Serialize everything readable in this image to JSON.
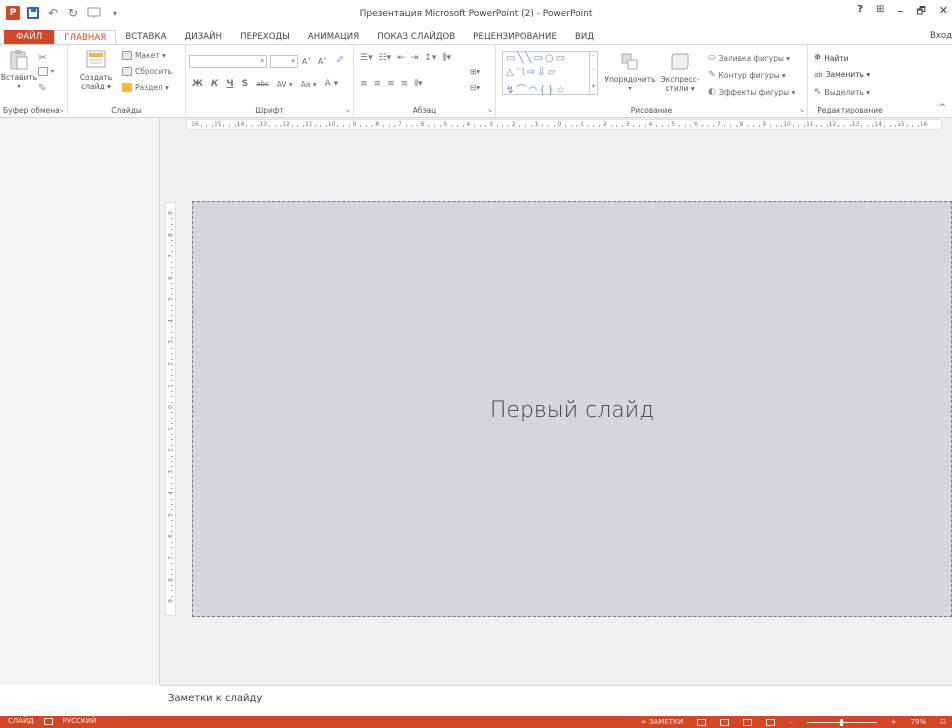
{
  "window": {
    "title": "Презентация Microsoft PowerPoint (2) - PowerPoint",
    "help": "?",
    "restore_ribbon": "⊞",
    "minimize": "–",
    "maximize": "🗗",
    "close": "✕"
  },
  "qat": {
    "app_icon": "P",
    "undo": "↶",
    "redo": "↻",
    "customize": "▾"
  },
  "tabs": [
    "ФАЙЛ",
    "ГЛАВНАЯ",
    "ВСТАВКА",
    "ДИЗАЙН",
    "ПЕРЕХОДЫ",
    "АНИМАЦИЯ",
    "ПОКАЗ СЛАЙДОВ",
    "РЕЦЕНЗИРОВАНИЕ",
    "ВИД"
  ],
  "active_tab": "ГЛАВНАЯ",
  "login": "Вход",
  "ribbon": {
    "clipboard": {
      "label": "Буфер обмена",
      "paste": "Вставить",
      "launcher": "↘"
    },
    "slides": {
      "label": "Слайды",
      "new_slide_1": "Создать",
      "new_slide_2": "слайд ▾",
      "layout": "Макет ▾",
      "reset": "Сбросить",
      "section": "Раздел ▾"
    },
    "font": {
      "label": "Шрифт",
      "bold": "Ж",
      "italic": "К",
      "underline": "Ч",
      "shadow": "S",
      "strike": "abc",
      "spacing": "AV ▾",
      "case": "Aa ▾",
      "color": "A ▾",
      "grow": "A˄",
      "shrink": "A˅",
      "clear": "⌫",
      "launcher": "↘"
    },
    "paragraph": {
      "label": "Абзац",
      "launcher": "↘"
    },
    "drawing": {
      "label": "Рисование",
      "arrange": "Упорядочить",
      "quick_styles_1": "Экспресс-",
      "quick_styles_2": "стили ▾",
      "fill": "Заливка фигуры ▾",
      "outline": "Контур фигуры ▾",
      "effects": "Эффекты фигуры ▾",
      "launcher": "↘"
    },
    "editing": {
      "label": "Редактирование",
      "find": "Найти",
      "replace": "Заменить ▾",
      "select": "Выделить ▾"
    },
    "collapse": "^"
  },
  "ruler": {
    "h_ticks": [
      "16",
      "15",
      "14",
      "13",
      "12",
      "11",
      "10",
      "9",
      "8",
      "7",
      "6",
      "5",
      "4",
      "3",
      "2",
      "1",
      "0",
      "1",
      "2",
      "3",
      "4",
      "5",
      "6",
      "7",
      "8",
      "9",
      "10",
      "11",
      "12",
      "13",
      "14",
      "15",
      "16"
    ],
    "v_ticks": [
      "9",
      "8",
      "7",
      "6",
      "5",
      "4",
      "3",
      "2",
      "1",
      "0",
      "1",
      "2",
      "3",
      "4",
      "5",
      "6",
      "7",
      "8",
      "9"
    ]
  },
  "slide": {
    "title": "Первый слайд",
    "background": "#d4d5df"
  },
  "notes": {
    "placeholder": "Заметки к слайду"
  },
  "status": {
    "slide": "СЛАЙД",
    "language": "РУССКИЙ",
    "notes": "≐ ЗАМЕТКИ",
    "zoom": "79%",
    "fit": "⊡"
  },
  "colors": {
    "accent": "#d24726",
    "ribbon_bg": "#ffffff",
    "pane_bg": "#f0f0f0"
  }
}
